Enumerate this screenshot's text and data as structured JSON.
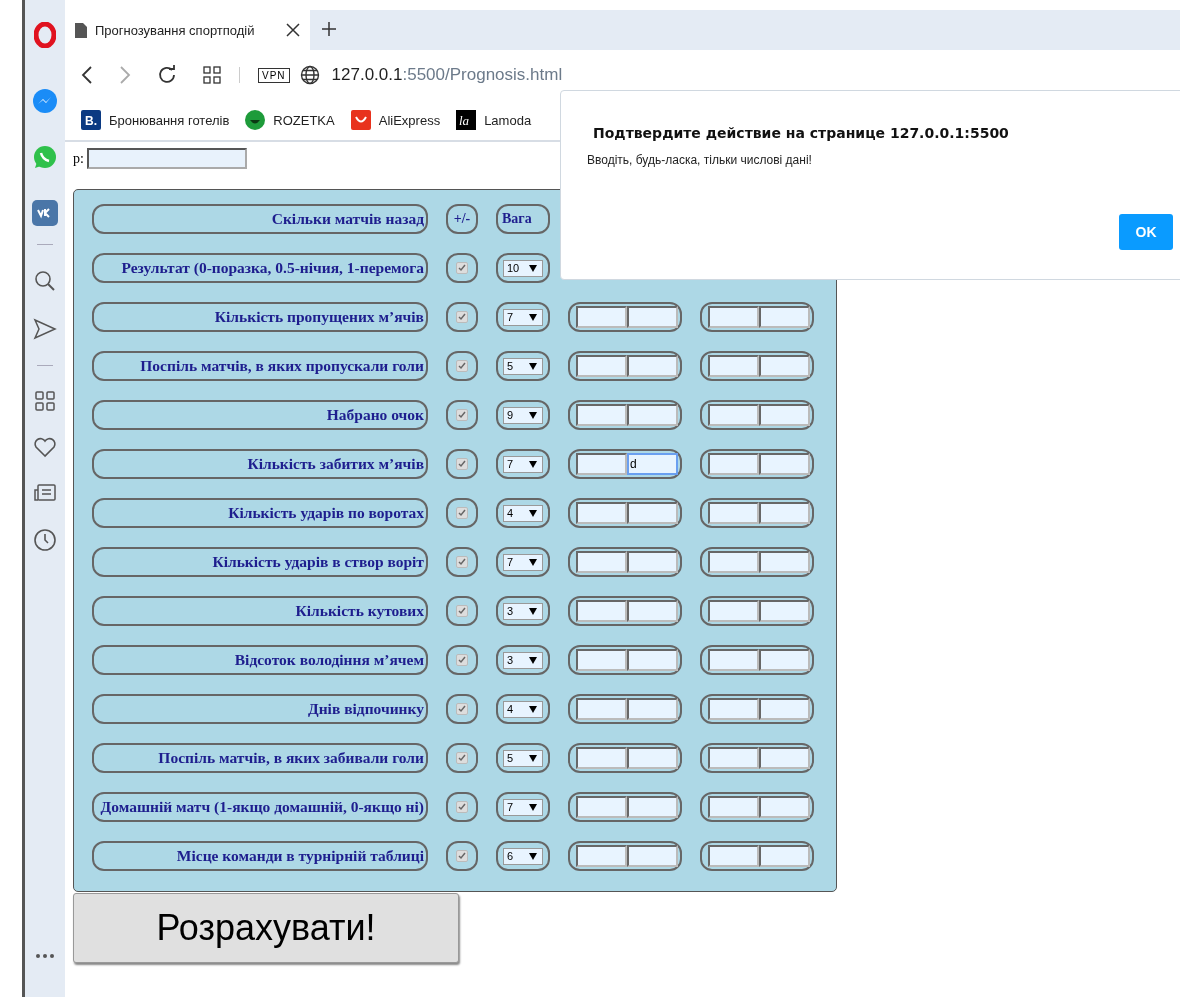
{
  "browser": {
    "tab": {
      "title": "Прогнозування спортподій",
      "selected": true
    },
    "address": {
      "host": "127.0.0.1",
      "rest": ":5500/Prognosis.html"
    },
    "vpn_label": "VPN",
    "bookmarks": [
      {
        "label": "Бронювання готелів",
        "kind": "booking",
        "logo_text": "B."
      },
      {
        "label": "ROZETKA",
        "kind": "rozetka"
      },
      {
        "label": "AliExpress",
        "kind": "ali"
      },
      {
        "label": "Lamoda",
        "kind": "lamoda",
        "logo_text": "la"
      }
    ]
  },
  "page": {
    "p_label": "p:",
    "header": {
      "label": "Скільки матчів назад",
      "toggle": "+/-",
      "weight": "Вага"
    },
    "rows": [
      {
        "label": "Результат (0-поразка, 0.5-нічия, 1-перемога",
        "checked": true,
        "weight": "10"
      },
      {
        "label": "Кількість пропущених м’ячів",
        "checked": true,
        "weight": "7",
        "fields": [
          {
            "focused": false
          },
          {
            "focused": false
          },
          {
            "focused": false
          },
          {
            "focused": false
          }
        ]
      },
      {
        "label": "Поспіль матчів, в яких пропускали голи",
        "checked": true,
        "weight": "5",
        "fields": [
          {
            "focused": false
          },
          {
            "focused": false
          },
          {
            "focused": false
          },
          {
            "focused": false
          }
        ]
      },
      {
        "label": "Набрано очок",
        "checked": true,
        "weight": "9",
        "fields": [
          {
            "focused": false
          },
          {
            "focused": false
          },
          {
            "focused": false
          },
          {
            "focused": false
          }
        ]
      },
      {
        "label": "Кількість забитих м’ячів",
        "checked": true,
        "weight": "7",
        "fields": [
          {
            "focused": false
          },
          {
            "focused": true,
            "value": "d"
          },
          {
            "focused": false
          },
          {
            "focused": false
          }
        ]
      },
      {
        "label": "Кількість ударів по воротах",
        "checked": true,
        "weight": "4",
        "fields": [
          {
            "focused": false
          },
          {
            "focused": false
          },
          {
            "focused": false
          },
          {
            "focused": false
          }
        ]
      },
      {
        "label": "Кількість ударів в створ воріт",
        "checked": true,
        "weight": "7",
        "fields": [
          {
            "focused": false
          },
          {
            "focused": false
          },
          {
            "focused": false
          },
          {
            "focused": false
          }
        ]
      },
      {
        "label": "Кількість кутових",
        "checked": true,
        "weight": "3",
        "fields": [
          {
            "focused": false
          },
          {
            "focused": false
          },
          {
            "focused": false
          },
          {
            "focused": false
          }
        ]
      },
      {
        "label": "Відсоток володіння м’ячем",
        "checked": true,
        "weight": "3",
        "fields": [
          {
            "focused": false
          },
          {
            "focused": false
          },
          {
            "focused": false
          },
          {
            "focused": false
          }
        ]
      },
      {
        "label": "Днів відпочинку",
        "checked": true,
        "weight": "4",
        "fields": [
          {
            "focused": false
          },
          {
            "focused": false
          },
          {
            "focused": false
          },
          {
            "focused": false
          }
        ]
      },
      {
        "label": "Поспіль матчів, в яких забивали голи",
        "checked": true,
        "weight": "5",
        "fields": [
          {
            "focused": false
          },
          {
            "focused": false
          },
          {
            "focused": false
          },
          {
            "focused": false
          }
        ]
      },
      {
        "label": "Домашній матч (1-якщо домашній, 0-якщо ні)",
        "checked": true,
        "weight": "7",
        "fields": [
          {
            "focused": false
          },
          {
            "focused": false
          },
          {
            "focused": false
          },
          {
            "focused": false
          }
        ]
      },
      {
        "label": "Місце команди в турнірній таблиці",
        "checked": true,
        "weight": "6",
        "fields": [
          {
            "focused": false
          },
          {
            "focused": false
          },
          {
            "focused": false
          },
          {
            "focused": false
          }
        ]
      }
    ],
    "submit": "Розрахувати!"
  },
  "dialog": {
    "title": "Подтвердите действие на странице 127.0.0.1:5500",
    "message": "Вводіть, будь-ласка, тільки числові дані!",
    "ok": "OK"
  }
}
